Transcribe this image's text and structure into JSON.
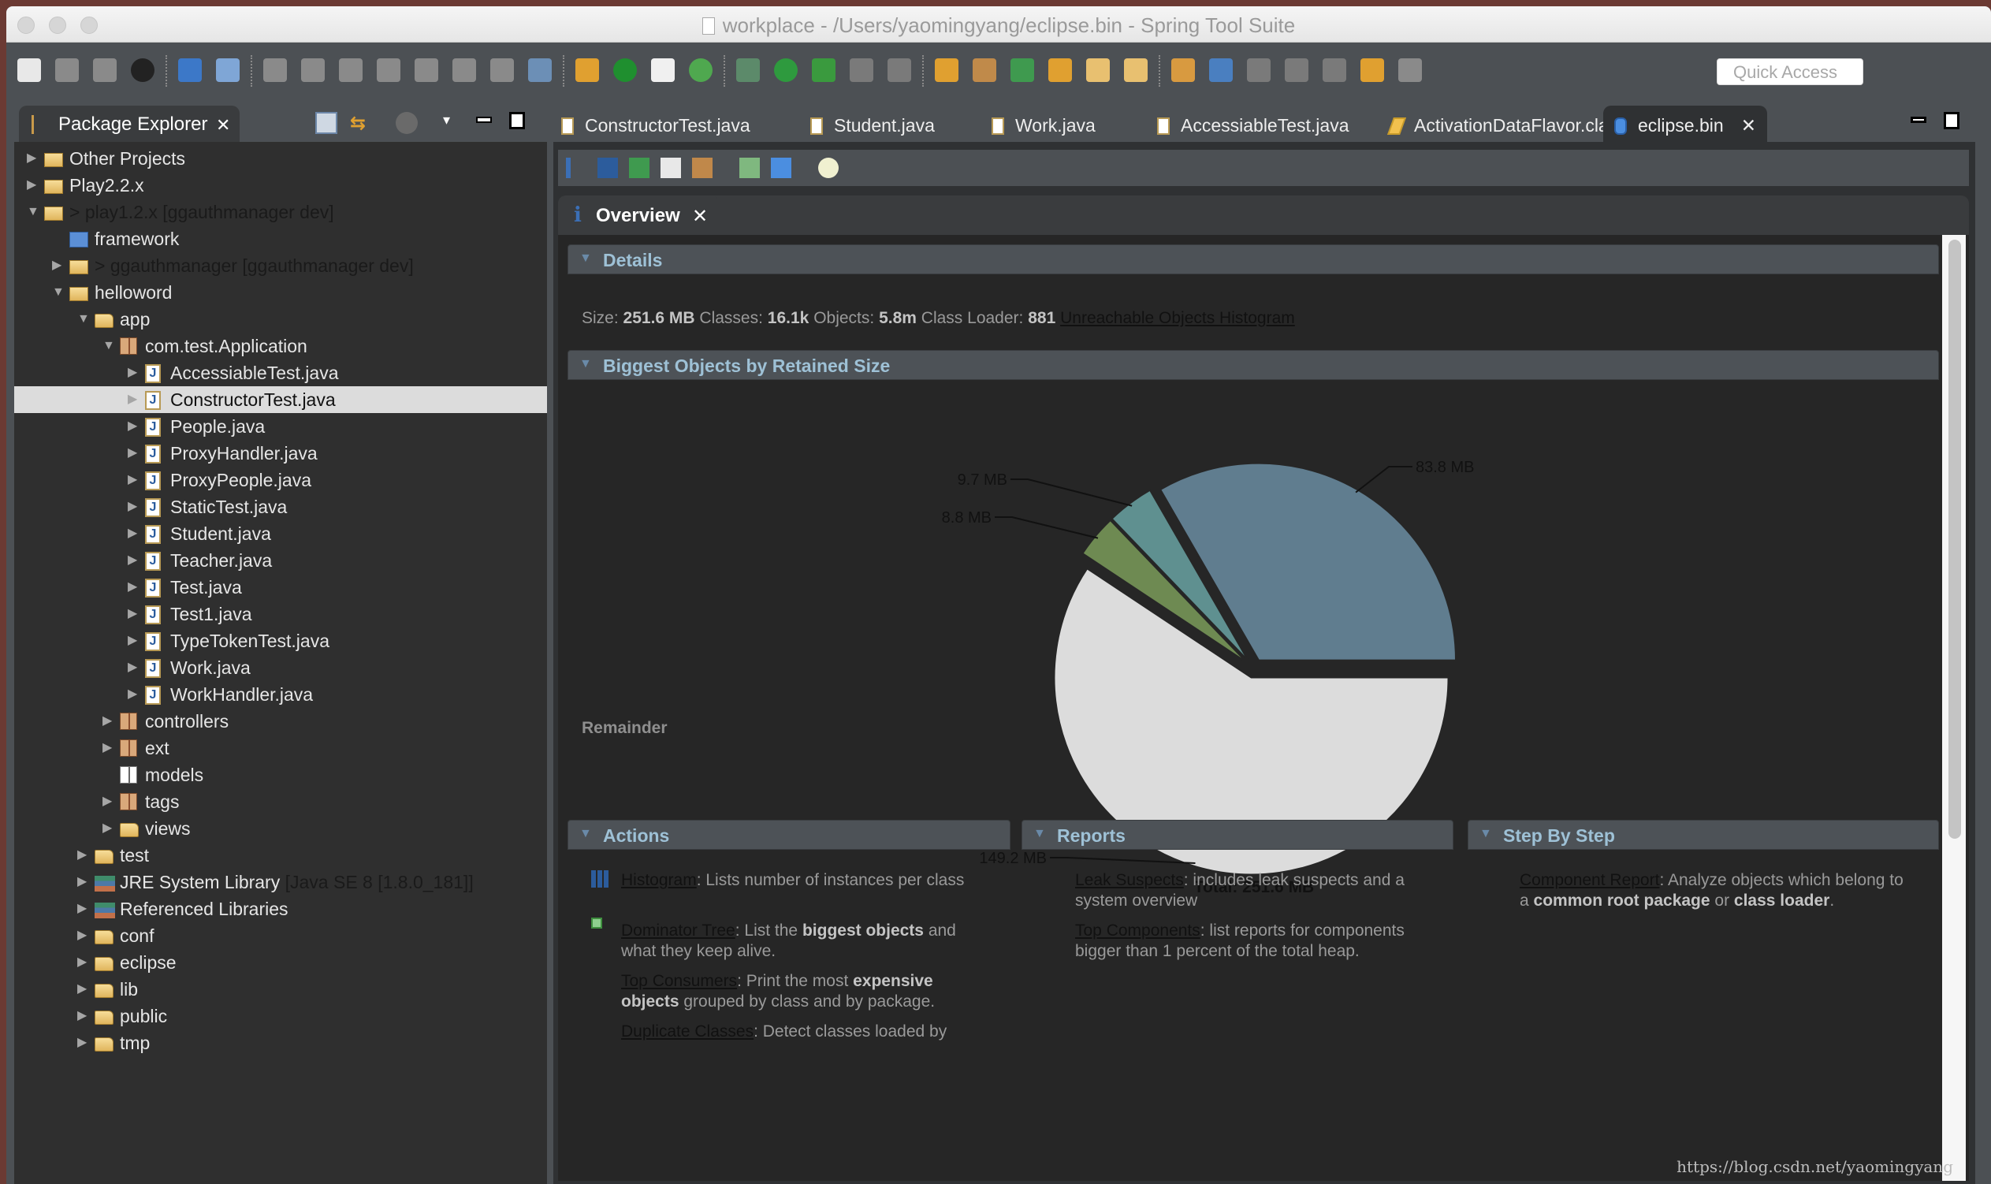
{
  "window": {
    "title": "workplace - /Users/yaomingyang/eclipse.bin - Spring Tool Suite"
  },
  "toolbar": {
    "quick_access_placeholder": "Quick Access",
    "icons": [
      "new-wizard-icon",
      "save-icon",
      "save-all-icon",
      "profile-icon",
      "task-icon",
      "skip-breakpoints-icon",
      "resume-icon",
      "suspend-icon",
      "terminate-icon",
      "disconnect-icon",
      "step-into-icon",
      "step-over-icon",
      "step-return-icon",
      "drop-to-frame-icon",
      "use-step-filters-icon",
      "spring-boot-icon",
      "line-numbers-icon",
      "spring-icon",
      "debug-icon",
      "run-icon",
      "external-tools-icon",
      "stop-icon",
      "coverage-icon",
      "new-java-project-icon",
      "new-package-icon",
      "new-class-icon",
      "open-type-icon",
      "open-task-icon",
      "search-icon",
      "open-folder-icon",
      "globe-icon",
      "next-annotation-icon",
      "previous-annotation-icon",
      "last-edit-icon",
      "back-icon",
      "forward-icon"
    ]
  },
  "package_explorer": {
    "title": "Package Explorer",
    "tree": [
      {
        "label": "Other Projects",
        "depth": 0,
        "expand": "collapsed",
        "icon": "working-set"
      },
      {
        "label": "Play2.2.x",
        "depth": 0,
        "expand": "collapsed",
        "icon": "working-set"
      },
      {
        "label": "> play1.2.x",
        "suffix": " [ggauthmanager dev]",
        "depth": 0,
        "expand": "expanded",
        "icon": "project-warning",
        "dim": true
      },
      {
        "label": "framework",
        "depth": 1,
        "expand": "none",
        "icon": "blue-folder"
      },
      {
        "label": "> ggauthmanager",
        "suffix": " [ggauthmanager dev]",
        "depth": 1,
        "expand": "collapsed",
        "icon": "project-warning",
        "dim": true
      },
      {
        "label": "helloword",
        "depth": 1,
        "expand": "expanded",
        "icon": "project-warning"
      },
      {
        "label": "app",
        "depth": 2,
        "expand": "expanded",
        "icon": "source-folder"
      },
      {
        "label": "com.test.Application",
        "depth": 3,
        "expand": "expanded",
        "icon": "package"
      },
      {
        "label": "AccessiableTest.java",
        "depth": 4,
        "expand": "collapsed",
        "icon": "java"
      },
      {
        "label": "ConstructorTest.java",
        "depth": 4,
        "expand": "collapsed",
        "icon": "java",
        "selected": true
      },
      {
        "label": "People.java",
        "depth": 4,
        "expand": "collapsed",
        "icon": "java-interface"
      },
      {
        "label": "ProxyHandler.java",
        "depth": 4,
        "expand": "collapsed",
        "icon": "java"
      },
      {
        "label": "ProxyPeople.java",
        "depth": 4,
        "expand": "collapsed",
        "icon": "java"
      },
      {
        "label": "StaticTest.java",
        "depth": 4,
        "expand": "collapsed",
        "icon": "java-warning"
      },
      {
        "label": "Student.java",
        "depth": 4,
        "expand": "collapsed",
        "icon": "java"
      },
      {
        "label": "Teacher.java",
        "depth": 4,
        "expand": "collapsed",
        "icon": "java"
      },
      {
        "label": "Test.java",
        "depth": 4,
        "expand": "collapsed",
        "icon": "java"
      },
      {
        "label": "Test1.java",
        "depth": 4,
        "expand": "collapsed",
        "icon": "java"
      },
      {
        "label": "TypeTokenTest.java",
        "depth": 4,
        "expand": "collapsed",
        "icon": "java-warning"
      },
      {
        "label": "Work.java",
        "depth": 4,
        "expand": "collapsed",
        "icon": "java"
      },
      {
        "label": "WorkHandler.java",
        "depth": 4,
        "expand": "collapsed",
        "icon": "java"
      },
      {
        "label": "controllers",
        "depth": 3,
        "expand": "collapsed",
        "icon": "package"
      },
      {
        "label": "ext",
        "depth": 3,
        "expand": "collapsed",
        "icon": "package"
      },
      {
        "label": "models",
        "depth": 3,
        "expand": "none",
        "icon": "package-empty"
      },
      {
        "label": "tags",
        "depth": 3,
        "expand": "collapsed",
        "icon": "package"
      },
      {
        "label": "views",
        "depth": 3,
        "expand": "collapsed",
        "icon": "folder"
      },
      {
        "label": "test",
        "depth": 2,
        "expand": "collapsed",
        "icon": "source-folder"
      },
      {
        "label": "JRE System Library",
        "suffix": " [Java SE 8 [1.8.0_181]]",
        "depth": 2,
        "expand": "collapsed",
        "icon": "library"
      },
      {
        "label": "Referenced Libraries",
        "depth": 2,
        "expand": "collapsed",
        "icon": "library"
      },
      {
        "label": "conf",
        "depth": 2,
        "expand": "collapsed",
        "icon": "folder"
      },
      {
        "label": "eclipse",
        "depth": 2,
        "expand": "collapsed",
        "icon": "folder"
      },
      {
        "label": "lib",
        "depth": 2,
        "expand": "collapsed",
        "icon": "folder"
      },
      {
        "label": "public",
        "depth": 2,
        "expand": "collapsed",
        "icon": "folder"
      },
      {
        "label": "tmp",
        "depth": 2,
        "expand": "collapsed",
        "icon": "folder"
      }
    ]
  },
  "editor": {
    "tabs": [
      {
        "label": "ConstructorTest.java",
        "icon": "java-file-icon"
      },
      {
        "label": "Student.java",
        "icon": "java-file-icon"
      },
      {
        "label": "Work.java",
        "icon": "java-file-icon"
      },
      {
        "label": "AccessiableTest.java",
        "icon": "java-file-icon"
      },
      {
        "label": "ActivationDataFlavor.class",
        "icon": "class-file-icon"
      },
      {
        "label": "eclipse.bin",
        "icon": "heap-dump-icon",
        "active": true
      }
    ],
    "mat_toolbar_icons": [
      "overview-icon",
      "histogram-icon",
      "dominator-tree-icon",
      "oql-icon",
      "thread-overview-icon",
      "query-browser-icon",
      "heap-dump-query-icon",
      "find-object-icon"
    ],
    "overview_tab": "Overview"
  },
  "details": {
    "heading": "Details",
    "size_label": "Size:",
    "size_value": "251.6 MB",
    "classes_label": "Classes:",
    "classes_value": "16.1k",
    "objects_label": "Objects:",
    "objects_value": "5.8m",
    "loader_label": "Class Loader:",
    "loader_value": "881",
    "link": "Unreachable Objects Histogram"
  },
  "biggest_objects": {
    "heading": "Biggest Objects by Retained Size",
    "remainder_label": "Remainder"
  },
  "chart_data": {
    "type": "pie",
    "title": "Biggest Objects by Retained Size",
    "unit": "MB",
    "slices": [
      {
        "label": "83.8 MB",
        "value": 83.8,
        "color": "#607d8f"
      },
      {
        "label": "9.7 MB",
        "value": 9.7,
        "color": "#5f9090"
      },
      {
        "label": "8.8 MB",
        "value": 8.8,
        "color": "#6e8a52"
      },
      {
        "label": "149.2 MB",
        "value": 149.2,
        "color": "#dcdcdc",
        "name": "Remainder"
      }
    ],
    "total_label": "Total: 251.6 MB",
    "start_angle_deg": 0,
    "direction": "counterclockwise"
  },
  "actions": {
    "heading": "Actions",
    "items": [
      {
        "link": "Histogram",
        "text": ": Lists number of instances per class",
        "icon": "histogram-icon"
      },
      {
        "link": "Dominator Tree",
        "text_pre": ": List the ",
        "bold": "biggest objects",
        "text_post": " and what they keep alive.",
        "icon": "dominator-tree-icon"
      },
      {
        "link": "Top Consumers",
        "text_pre": ": Print the most ",
        "bold": "expensive objects",
        "text_post": " grouped by class and by package."
      },
      {
        "link": "Duplicate Classes",
        "text": ": Detect classes loaded by"
      }
    ]
  },
  "reports": {
    "heading": "Reports",
    "items": [
      {
        "link": "Leak Suspects",
        "text": ": includes leak suspects and a system overview"
      },
      {
        "link": "Top Components",
        "text": ": list reports for components bigger than 1 percent of the total heap."
      }
    ]
  },
  "step_by_step": {
    "heading": "Step By Step",
    "items": [
      {
        "link": "Component Report",
        "text_pre": ": Analyze objects which belong to a ",
        "bold1": "common root package",
        "mid": " or ",
        "bold2": "class loader",
        "text_post": "."
      }
    ]
  },
  "watermark": "https://blog.csdn.net/yaomingyang"
}
